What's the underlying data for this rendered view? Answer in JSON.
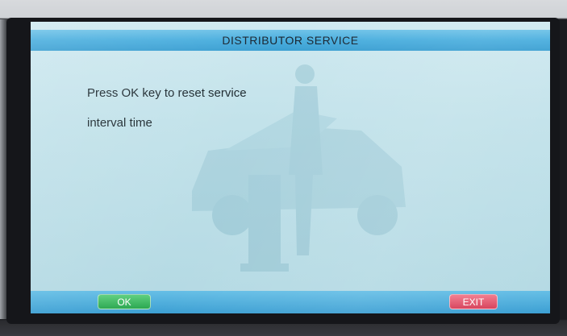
{
  "screen": {
    "title": "DISTRIBUTOR SERVICE",
    "message_lines": [
      "Press OK key to reset service",
      "interval time"
    ]
  },
  "footer": {
    "ok_label": "OK",
    "exit_label": "EXIT"
  },
  "colors": {
    "title_bar": "#4aaede",
    "screen_bg": "#c2e2ea",
    "ok_button": "#2aa750",
    "exit_button": "#d6405a"
  },
  "icons": {
    "background": "mechanic-servicing-car-illustration"
  }
}
